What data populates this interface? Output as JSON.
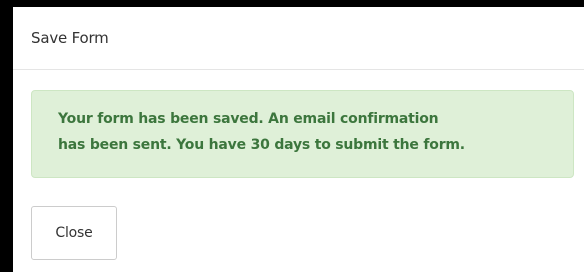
{
  "modal": {
    "title": "Save Form",
    "alert": {
      "line1": "Your form has been saved. An email confirmation",
      "line2": "has been sent. You have 30 days to submit the form.",
      "status_color": "#3c763d",
      "background_color": "#dff0d8"
    },
    "close_label": "Close"
  }
}
